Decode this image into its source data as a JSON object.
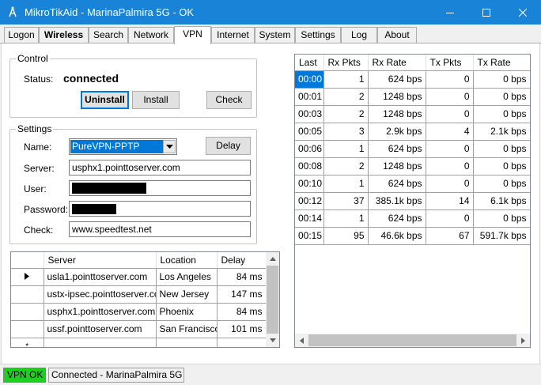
{
  "window": {
    "title": "MikroTikAid - MarinaPalmira 5G - OK"
  },
  "tabs": [
    {
      "label": "Logon",
      "bold": false
    },
    {
      "label": "Wireless",
      "bold": true
    },
    {
      "label": "Search",
      "bold": false
    },
    {
      "label": "Network",
      "bold": false
    },
    {
      "label": "VPN",
      "bold": false,
      "active": true
    },
    {
      "label": "Internet",
      "bold": false
    },
    {
      "label": "System",
      "bold": false
    },
    {
      "label": "Settings",
      "bold": false
    },
    {
      "label": "Log",
      "bold": false
    },
    {
      "label": "About",
      "bold": false
    }
  ],
  "control": {
    "legend": "Control",
    "status_label": "Status:",
    "status_value": "connected",
    "uninstall_label": "Uninstall",
    "install_label": "Install",
    "check_label": "Check"
  },
  "settings": {
    "legend": "Settings",
    "name_label": "Name:",
    "name_value": "PureVPN-PPTP",
    "delay_label": "Delay",
    "server_label": "Server:",
    "server_value": "usphx1.pointtoserver.com",
    "user_label": "User:",
    "password_label": "Password:",
    "check_label": "Check:",
    "check_value": "www.speedtest.net"
  },
  "servers": {
    "columns": [
      "Server",
      "Location",
      "Delay"
    ],
    "rows": [
      {
        "server": "usla1.pointtoserver.com",
        "location": "Los Angeles",
        "delay": "84 ms",
        "current": true
      },
      {
        "server": "ustx-ipsec.pointtoserver.com",
        "location": "New Jersey",
        "delay": "147 ms"
      },
      {
        "server": "usphx1.pointtoserver.com",
        "location": "Phoenix",
        "delay": "84 ms"
      },
      {
        "server": "ussf.pointtoserver.com",
        "location": "San Francisco",
        "delay": "101 ms"
      }
    ],
    "new_row_marker": "*"
  },
  "traffic": {
    "columns": [
      "Last",
      "Rx Pkts",
      "Rx Rate",
      "Tx Pkts",
      "Tx Rate"
    ],
    "rows": [
      {
        "last": "00:00",
        "rx_pkts": "1",
        "rx_rate": "624 bps",
        "tx_pkts": "0",
        "tx_rate": "0 bps"
      },
      {
        "last": "00:01",
        "rx_pkts": "2",
        "rx_rate": "1248 bps",
        "tx_pkts": "0",
        "tx_rate": "0 bps"
      },
      {
        "last": "00:03",
        "rx_pkts": "2",
        "rx_rate": "1248 bps",
        "tx_pkts": "0",
        "tx_rate": "0 bps"
      },
      {
        "last": "00:05",
        "rx_pkts": "3",
        "rx_rate": "2.9k bps",
        "tx_pkts": "4",
        "tx_rate": "2.1k bps"
      },
      {
        "last": "00:06",
        "rx_pkts": "1",
        "rx_rate": "624 bps",
        "tx_pkts": "0",
        "tx_rate": "0 bps"
      },
      {
        "last": "00:08",
        "rx_pkts": "2",
        "rx_rate": "1248 bps",
        "tx_pkts": "0",
        "tx_rate": "0 bps"
      },
      {
        "last": "00:10",
        "rx_pkts": "1",
        "rx_rate": "624 bps",
        "tx_pkts": "0",
        "tx_rate": "0 bps"
      },
      {
        "last": "00:12",
        "rx_pkts": "37",
        "rx_rate": "385.1k bps",
        "tx_pkts": "14",
        "tx_rate": "6.1k bps"
      },
      {
        "last": "00:14",
        "rx_pkts": "1",
        "rx_rate": "624 bps",
        "tx_pkts": "0",
        "tx_rate": "0 bps"
      },
      {
        "last": "00:15",
        "rx_pkts": "95",
        "rx_rate": "46.6k bps",
        "tx_pkts": "67",
        "tx_rate": "591.7k bps"
      }
    ]
  },
  "statusbar": {
    "vpn_status": "VPN OK",
    "connection_text": "Connected - MarinaPalmira 5G"
  },
  "colors": {
    "titlebar": "#1883d7",
    "selection": "#0078d7",
    "vpn_ok": "#1fcf1f"
  }
}
